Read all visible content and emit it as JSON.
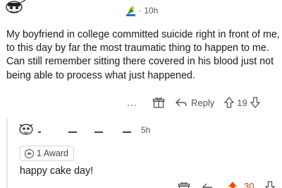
{
  "post": {
    "time": "10h",
    "body": "My boyfriend in college committed suicide right in front of me, to this day by far the most traumatic thing to happen to me. Can still remember sitting there covered in his blood just not being able to process what just happened.",
    "more_label": "...",
    "reply_label": "Reply",
    "score": "19",
    "icons": [
      "avatar-icon",
      "award-icon",
      "gift-icon",
      "reply-icon",
      "upvote-icon",
      "downvote-icon"
    ]
  },
  "reply": {
    "time": "5h",
    "award_label": "1 Award",
    "body": "happy cake day!",
    "score": "30",
    "accent_color": "#ff4500",
    "score_color": "#d93a00"
  }
}
